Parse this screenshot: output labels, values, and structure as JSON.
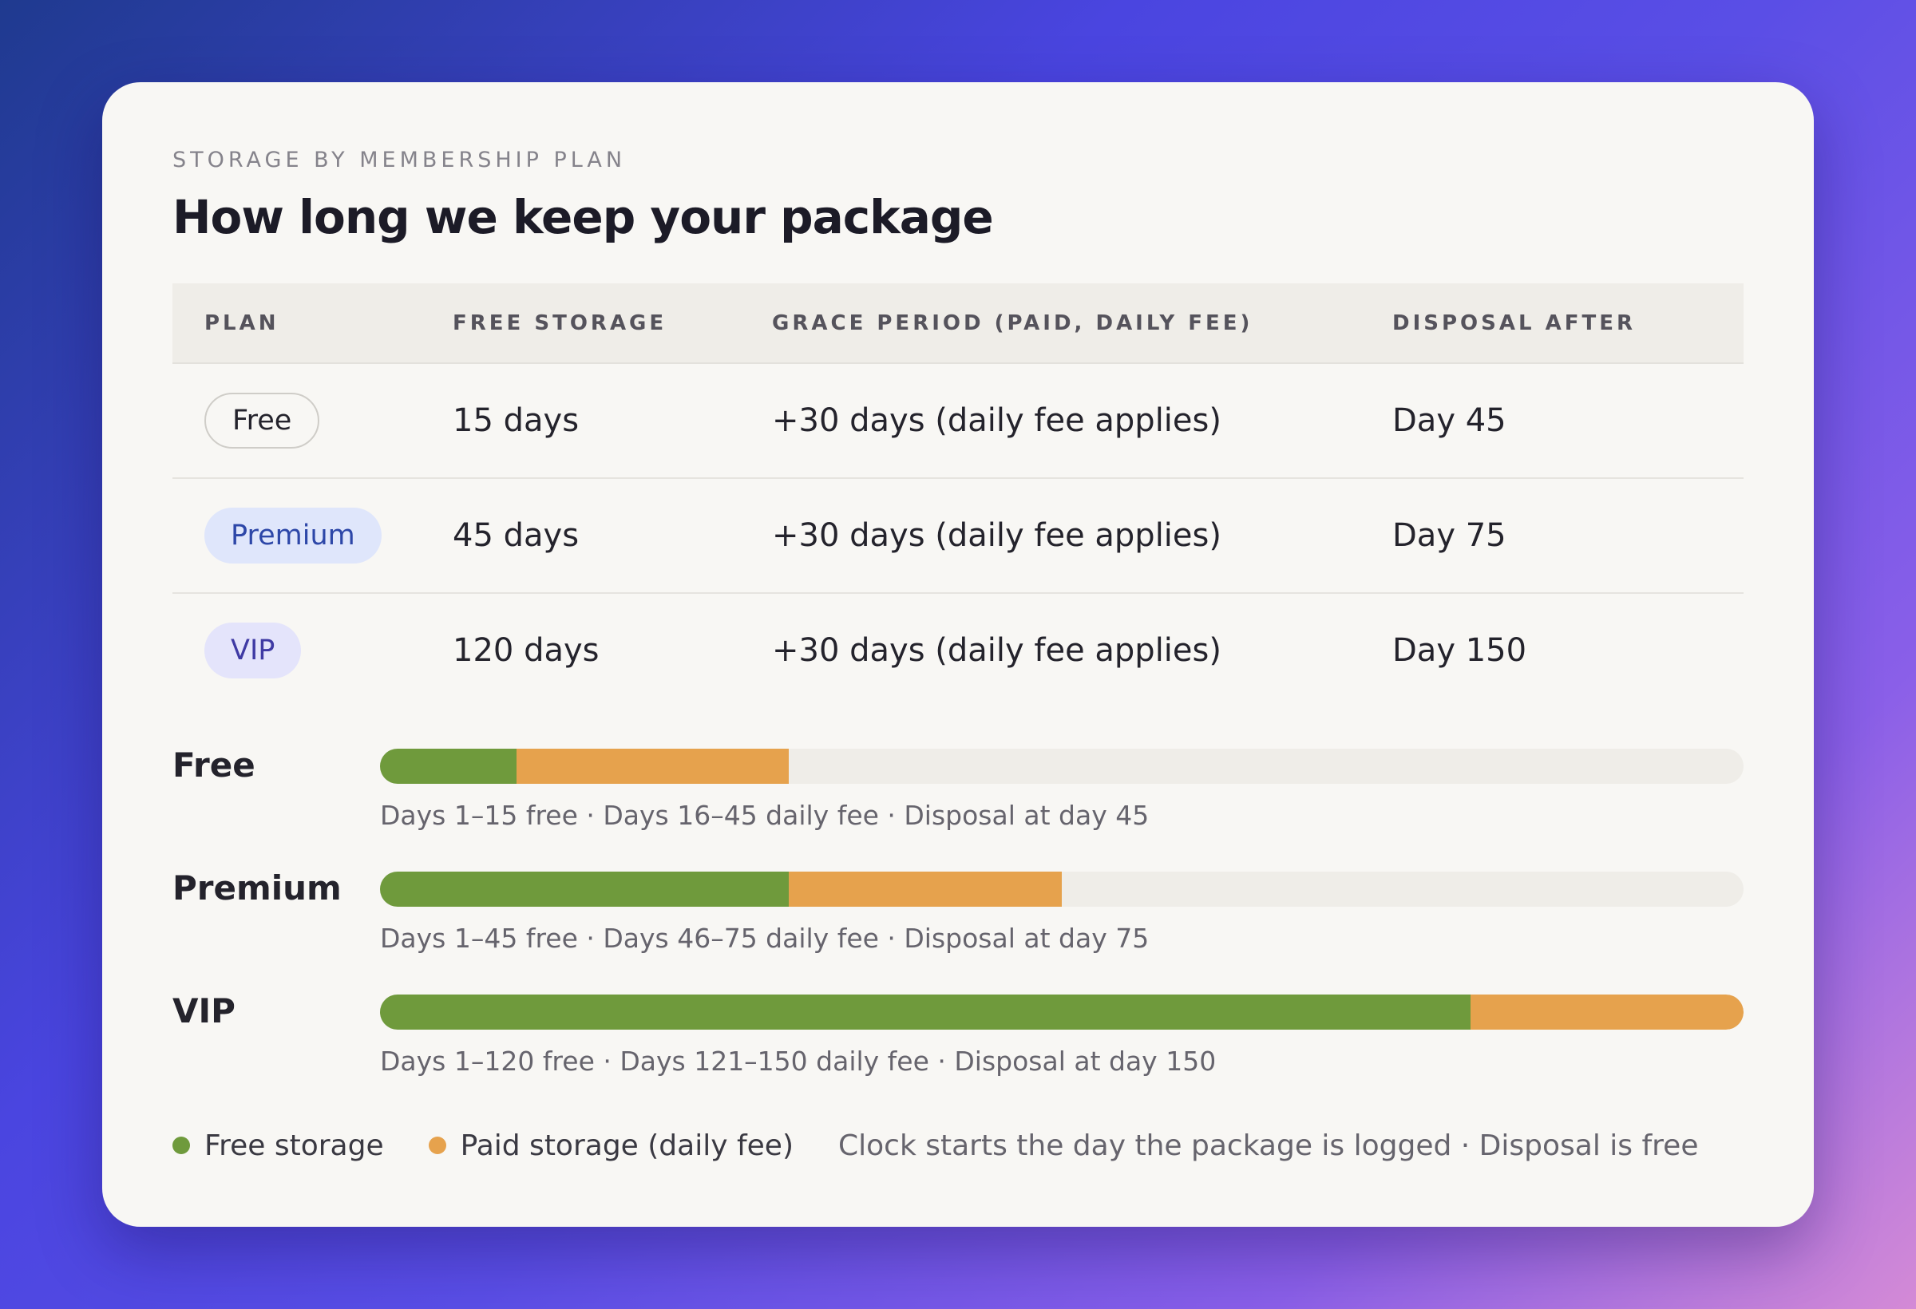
{
  "header": {
    "eyebrow": "STORAGE BY MEMBERSHIP PLAN",
    "title": "How long we keep your package"
  },
  "table": {
    "columns": [
      "PLAN",
      "FREE STORAGE",
      "GRACE PERIOD (PAID, DAILY FEE)",
      "DISPOSAL AFTER"
    ],
    "rows": [
      {
        "plan": "Free",
        "free_storage": "15 days",
        "grace": "+30 days (daily fee applies)",
        "disposal": "Day 45"
      },
      {
        "plan": "Premium",
        "free_storage": "45 days",
        "grace": "+30 days (daily fee applies)",
        "disposal": "Day 75"
      },
      {
        "plan": "VIP",
        "free_storage": "120 days",
        "grace": "+30 days (daily fee applies)",
        "disposal": "Day 150"
      }
    ]
  },
  "timelines": {
    "max_day": 150,
    "items": [
      {
        "plan": "Free",
        "free_days": 15,
        "total_days": 45,
        "note": "Days 1–15 free · Days 16–45 daily fee · Disposal at day 45"
      },
      {
        "plan": "Premium",
        "free_days": 45,
        "total_days": 75,
        "note": "Days 1–45 free · Days 46–75 daily fee · Disposal at day 75"
      },
      {
        "plan": "VIP",
        "free_days": 120,
        "total_days": 150,
        "note": "Days 1–120 free · Days 121–150 daily fee · Disposal at day 150"
      }
    ]
  },
  "legend": {
    "free_label": "Free storage",
    "paid_label": "Paid storage (daily fee)",
    "note": "Clock starts the day the package is logged · Disposal is free"
  },
  "colors": {
    "free": "#6f9a3c",
    "paid": "#e6a24d",
    "track": "#efede8"
  }
}
